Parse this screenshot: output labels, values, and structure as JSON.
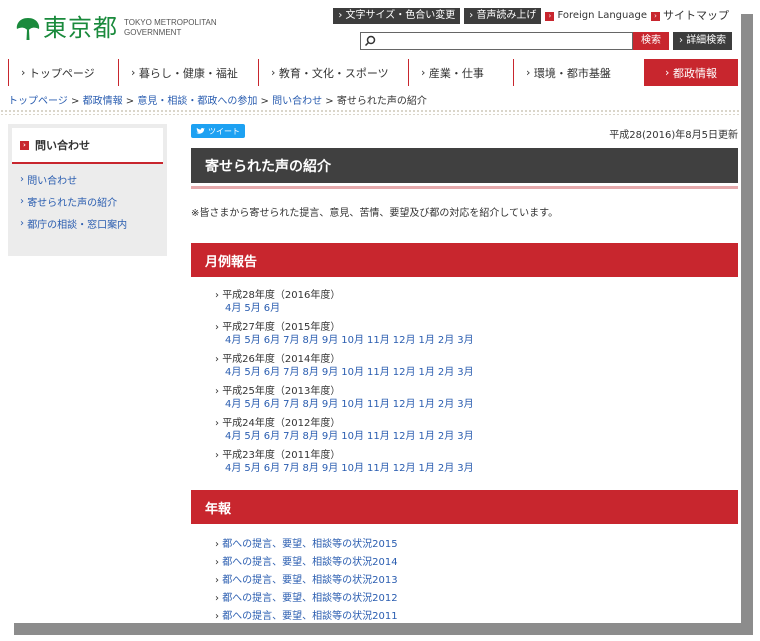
{
  "header": {
    "logo_text": "東京都",
    "logo_sub_line1": "TOKYO METROPOLITAN",
    "logo_sub_line2": "GOVERNMENT",
    "util_font_color": "文字サイズ・色合い変更",
    "util_voice": "音声読み上げ",
    "util_foreign": "Foreign Language",
    "util_sitemap": "サイトマップ",
    "search_placeholder": "",
    "search_button": "検索",
    "detail_search": "詳細検索"
  },
  "gnav": [
    {
      "label": "トップページ"
    },
    {
      "label": "暮らし・健康・福祉"
    },
    {
      "label": "教育・文化・スポーツ"
    },
    {
      "label": "産業・仕事"
    },
    {
      "label": "環境・都市基盤"
    },
    {
      "label": "都政情報"
    }
  ],
  "breadcrumb": {
    "items": [
      "トップページ",
      "都政情報",
      "意見・相談・都政への参加",
      "問い合わせ"
    ],
    "current": "寄せられた声の紹介",
    "sep": ">"
  },
  "sidebar": {
    "title": "問い合わせ",
    "items": [
      {
        "label": "問い合わせ"
      },
      {
        "label": "寄せられた声の紹介"
      },
      {
        "label": "都庁の相談・窓口案内"
      }
    ]
  },
  "main": {
    "tweet_label": "ツイート",
    "updated": "平成28(2016)年8月5日更新",
    "title": "寄せられた声の紹介",
    "lead": "※皆さまから寄せられた提言、意見、苦情、要望及び都の対応を紹介しています。",
    "monthly_heading": "月例報告",
    "years": [
      {
        "label": "平成28年度（2016年度）",
        "months": [
          "4月",
          "5月",
          "6月"
        ]
      },
      {
        "label": "平成27年度（2015年度）",
        "months": [
          "4月",
          "5月",
          "6月",
          "7月",
          "8月",
          "9月",
          "10月",
          "11月",
          "12月",
          "1月",
          "2月",
          "3月"
        ]
      },
      {
        "label": "平成26年度（2014年度）",
        "months": [
          "4月",
          "5月",
          "6月",
          "7月",
          "8月",
          "9月",
          "10月",
          "11月",
          "12月",
          "1月",
          "2月",
          "3月"
        ]
      },
      {
        "label": "平成25年度（2013年度）",
        "months": [
          "4月",
          "5月",
          "6月",
          "7月",
          "8月",
          "9月",
          "10月",
          "11月",
          "12月",
          "1月",
          "2月",
          "3月"
        ]
      },
      {
        "label": "平成24年度（2012年度）",
        "months": [
          "4月",
          "5月",
          "6月",
          "7月",
          "8月",
          "9月",
          "10月",
          "11月",
          "12月",
          "1月",
          "2月",
          "3月"
        ]
      },
      {
        "label": "平成23年度（2011年度）",
        "months": [
          "4月",
          "5月",
          "6月",
          "7月",
          "8月",
          "9月",
          "10月",
          "11月",
          "12月",
          "1月",
          "2月",
          "3月"
        ]
      }
    ],
    "annual_heading": "年報",
    "annual": [
      "都への提言、要望、相談等の状況2015",
      "都への提言、要望、相談等の状況2014",
      "都への提言、要望、相談等の状況2013",
      "都への提言、要望、相談等の状況2012",
      "都への提言、要望、相談等の状況2011"
    ]
  },
  "colors": {
    "accent_red": "#c8262e",
    "logo_green": "#1a8a3c",
    "link_blue": "#2a5db0",
    "dark_bar": "#404040"
  },
  "icons": [
    "ginkgo-logo-icon",
    "search-icon",
    "chevron-right-icon",
    "twitter-bird-icon"
  ]
}
